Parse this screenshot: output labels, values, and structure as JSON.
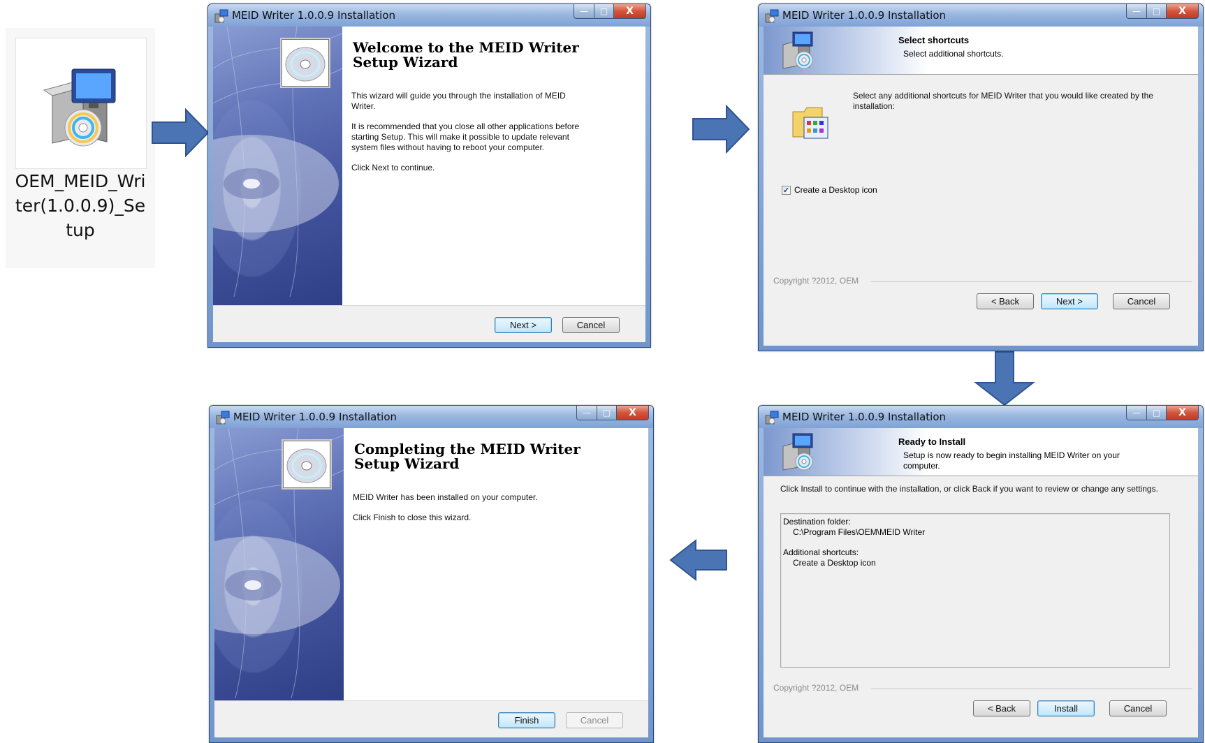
{
  "file_icon": {
    "filename": "OEM_MEID_Writer(1.0.0.9)_Setup",
    "icon": "installer-package-icon"
  },
  "window_title": "MEID Writer 1.0.0.9 Installation",
  "caption": {
    "min": "—",
    "max": "□",
    "close": "X"
  },
  "welcome": {
    "title": "Welcome to the MEID Writer Setup Wizard",
    "p1": "This wizard will guide you through the installation of MEID Writer.",
    "p2": "It is recommended that you close all other applications before starting Setup. This will make it possible to update relevant system files without having to reboot your computer.",
    "p3": "Click Next to continue.",
    "next_label": "Next >",
    "cancel_label": "Cancel"
  },
  "shortcuts": {
    "header_title": "Select shortcuts",
    "header_sub": "Select additional shortcuts.",
    "body": "Select any additional shortcuts for MEID Writer that you would like created by the installation:",
    "checkbox_label": "Create a Desktop icon",
    "checkbox_checked": true,
    "copyright": "Copyright ?2012, OEM",
    "back_label": "< Back",
    "next_label": "Next >",
    "cancel_label": "Cancel"
  },
  "ready": {
    "header_title": "Ready to Install",
    "header_sub": "Setup is now ready to begin installing MEID Writer on your computer.",
    "body": "Click Install to continue with the installation, or click Back if you want to review or change any settings.",
    "dest_label": "Destination folder:",
    "dest_value": "C:\\Program Files\\OEM\\MEID Writer",
    "shortcuts_label": "Additional shortcuts:",
    "shortcuts_value": "Create a Desktop icon",
    "copyright": "Copyright ?2012, OEM",
    "back_label": "< Back",
    "install_label": "Install",
    "cancel_label": "Cancel"
  },
  "complete": {
    "title": "Completing the MEID Writer Setup Wizard",
    "p1": "MEID Writer has been installed on your computer.",
    "p2": "Click Finish to close this wizard.",
    "finish_label": "Finish",
    "cancel_label": "Cancel"
  },
  "colors": {
    "arrow": "#4a74b4",
    "arrow_stroke": "#2e5491",
    "titlebar": "#9ab7e0",
    "close": "#c23a22"
  }
}
